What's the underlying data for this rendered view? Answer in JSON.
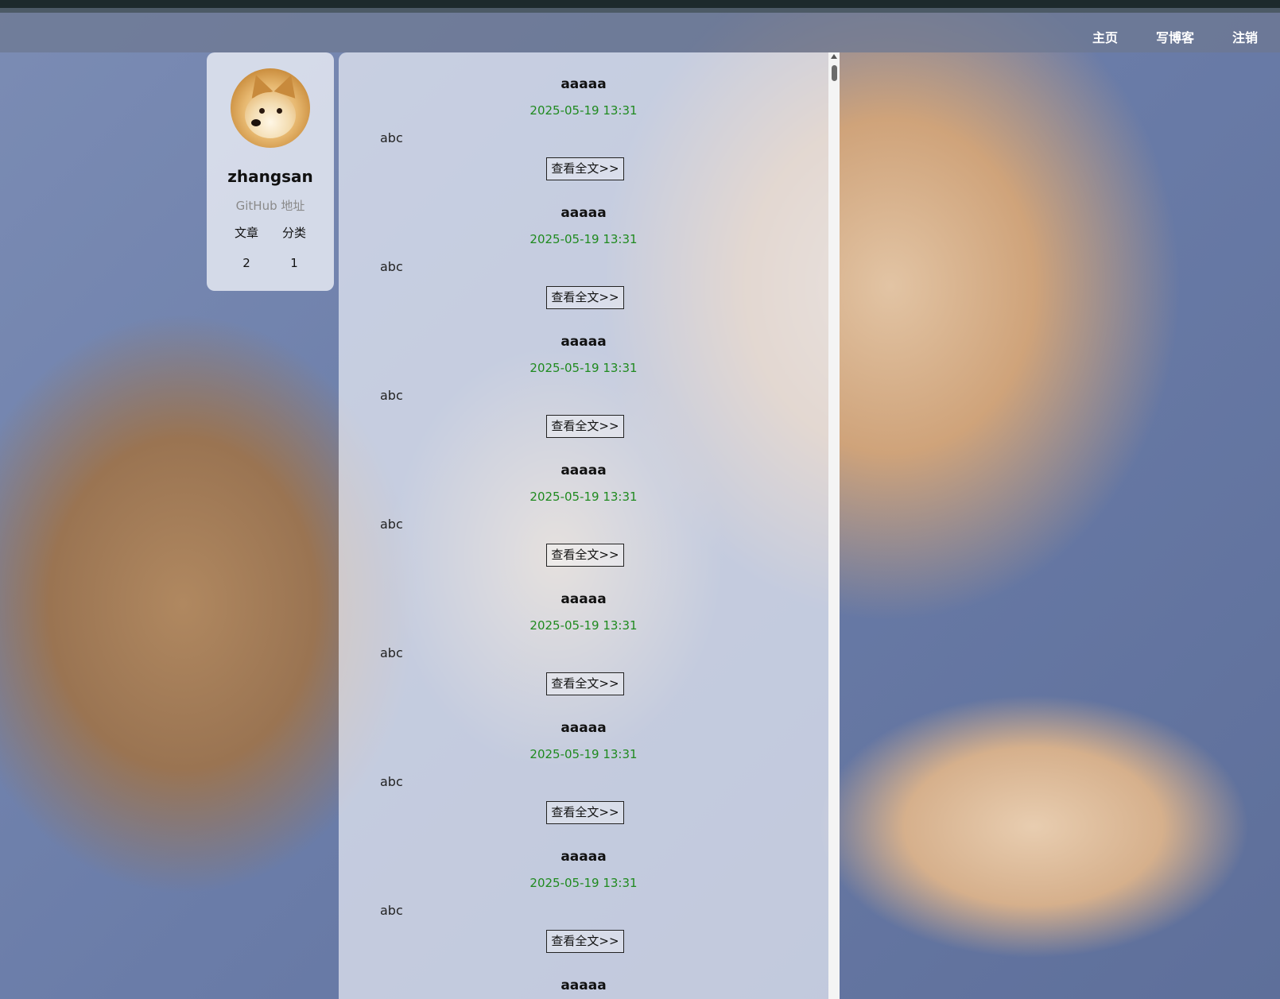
{
  "nav": {
    "items": [
      "主页",
      "写博客",
      "注销"
    ]
  },
  "profile": {
    "username": "zhangsan",
    "github_link": "GitHub 地址",
    "stats_labels": [
      "文章",
      "分类"
    ],
    "stats_values": [
      "2",
      "1"
    ]
  },
  "articles": [
    {
      "title": "aaaaa",
      "date": "2025-05-19 13:31",
      "desc": "abc",
      "more": "查看全文>>"
    },
    {
      "title": "aaaaa",
      "date": "2025-05-19 13:31",
      "desc": "abc",
      "more": "查看全文>>"
    },
    {
      "title": "aaaaa",
      "date": "2025-05-19 13:31",
      "desc": "abc",
      "more": "查看全文>>"
    },
    {
      "title": "aaaaa",
      "date": "2025-05-19 13:31",
      "desc": "abc",
      "more": "查看全文>>"
    },
    {
      "title": "aaaaa",
      "date": "2025-05-19 13:31",
      "desc": "abc",
      "more": "查看全文>>"
    },
    {
      "title": "aaaaa",
      "date": "2025-05-19 13:31",
      "desc": "abc",
      "more": "查看全文>>"
    },
    {
      "title": "aaaaa",
      "date": "2025-05-19 13:31",
      "desc": "abc",
      "more": "查看全文>>"
    },
    {
      "title": "aaaaa"
    }
  ],
  "colors": {
    "date_green": "#1f8a1f",
    "nav_bg": "#6e7891",
    "sofa_blue": "#6a7ca8"
  },
  "icons": {
    "avatar": "doge-avatar",
    "scroll": "scroll-up-arrow"
  }
}
